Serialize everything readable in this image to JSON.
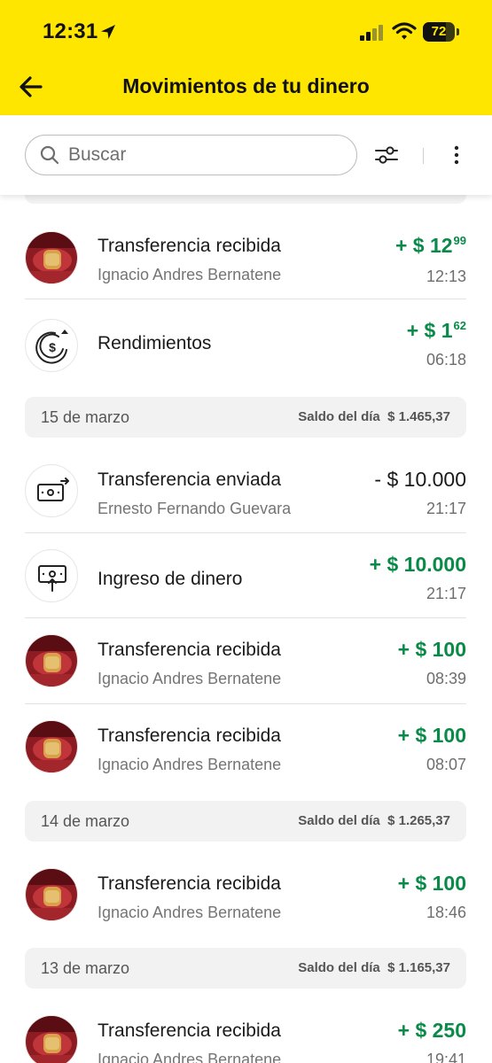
{
  "status_bar": {
    "time": "12:31",
    "battery": "72"
  },
  "header": {
    "title": "Movimientos de tu dinero"
  },
  "search": {
    "placeholder": "Buscar"
  },
  "groups": [
    {
      "date": "",
      "transactions": [
        {
          "title": "Transferencia recibida",
          "subtitle": "Ignacio Andres Bernatene",
          "amount_sign": "+",
          "amount": "$ 12",
          "cents": "99",
          "time": "12:13",
          "positive": true,
          "icon": "avatar-photo"
        },
        {
          "title": "Rendimientos",
          "subtitle": "",
          "amount_sign": "+",
          "amount": "$ 1",
          "cents": "62",
          "time": "06:18",
          "positive": true,
          "icon": "yield-icon"
        }
      ]
    },
    {
      "date": "15 de marzo",
      "balance_label": "Saldo del día",
      "balance": "$  1.465,37",
      "transactions": [
        {
          "title": "Transferencia enviada",
          "subtitle": "Ernesto Fernando Guevara",
          "amount_sign": "-",
          "amount": "$ 10.000",
          "cents": "",
          "time": "21:17",
          "positive": false,
          "icon": "transfer-out-icon"
        },
        {
          "title": "Ingreso de dinero",
          "subtitle": "",
          "amount_sign": "+",
          "amount": "$ 10.000",
          "cents": "",
          "time": "21:17",
          "positive": true,
          "icon": "deposit-icon"
        },
        {
          "title": "Transferencia recibida",
          "subtitle": "Ignacio Andres Bernatene",
          "amount_sign": "+",
          "amount": "$ 100",
          "cents": "",
          "time": "08:39",
          "positive": true,
          "icon": "avatar-photo"
        },
        {
          "title": "Transferencia recibida",
          "subtitle": "Ignacio Andres Bernatene",
          "amount_sign": "+",
          "amount": "$ 100",
          "cents": "",
          "time": "08:07",
          "positive": true,
          "icon": "avatar-photo"
        }
      ]
    },
    {
      "date": "14 de marzo",
      "balance_label": "Saldo del día",
      "balance": "$  1.265,37",
      "transactions": [
        {
          "title": "Transferencia recibida",
          "subtitle": "Ignacio Andres Bernatene",
          "amount_sign": "+",
          "amount": "$ 100",
          "cents": "",
          "time": "18:46",
          "positive": true,
          "icon": "avatar-photo"
        }
      ]
    },
    {
      "date": "13 de marzo",
      "balance_label": "Saldo del día",
      "balance": "$  1.165,37",
      "transactions": [
        {
          "title": "Transferencia recibida",
          "subtitle": "Ignacio Andres Bernatene",
          "amount_sign": "+",
          "amount": "$ 250",
          "cents": "",
          "time": "19:41",
          "positive": true,
          "icon": "avatar-photo"
        }
      ]
    }
  ],
  "colors": {
    "brand": "#ffe600",
    "positive": "#0a8a48",
    "muted": "#757575"
  }
}
